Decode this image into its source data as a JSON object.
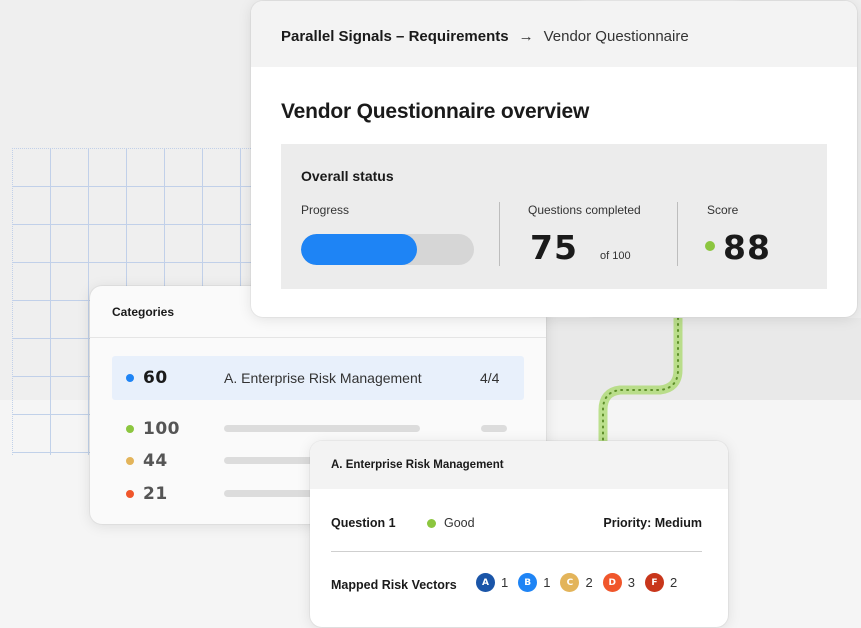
{
  "colors": {
    "accent_blue": "#1e84f5",
    "good_green": "#8cc63f",
    "amber": "#e3b45a",
    "red": "#f0562b"
  },
  "top_card": {
    "breadcrumb": {
      "parent": "Parallel Signals – Requirements",
      "separator_icon": "arrow-right-icon",
      "current": "Vendor Questionnaire"
    },
    "title": "Vendor Questionnaire overview",
    "overall_status": {
      "title": "Overall status",
      "progress_label": "Progress",
      "progress_fraction": 0.67,
      "questions_label": "Questions completed",
      "questions_value": "75",
      "questions_total": "of 100",
      "score_label": "Score",
      "score_value": "88"
    }
  },
  "categories": {
    "title": "Categories",
    "rows": [
      {
        "value": "60",
        "color": "#1e84f5",
        "name": "A. Enterprise Risk Management",
        "fraction": "4/4",
        "highlighted": true
      },
      {
        "value": "100",
        "color": "#8cc63f"
      },
      {
        "value": "44",
        "color": "#e3b45a"
      },
      {
        "value": "21",
        "color": "#f0562b"
      }
    ]
  },
  "detail_card": {
    "title": "A. Enterprise Risk Management",
    "question_label": "Question 1",
    "status": "Good",
    "priority": "Priority: Medium",
    "mapped_label": "Mapped Risk Vectors",
    "vectors": [
      {
        "letter": "A",
        "count": "1",
        "color": "#1a55a8"
      },
      {
        "letter": "B",
        "count": "1",
        "color": "#1e84f5"
      },
      {
        "letter": "C",
        "count": "2",
        "color": "#e3b45a"
      },
      {
        "letter": "D",
        "count": "3",
        "color": "#f0562b"
      },
      {
        "letter": "F",
        "count": "2",
        "color": "#c8361b"
      }
    ]
  }
}
